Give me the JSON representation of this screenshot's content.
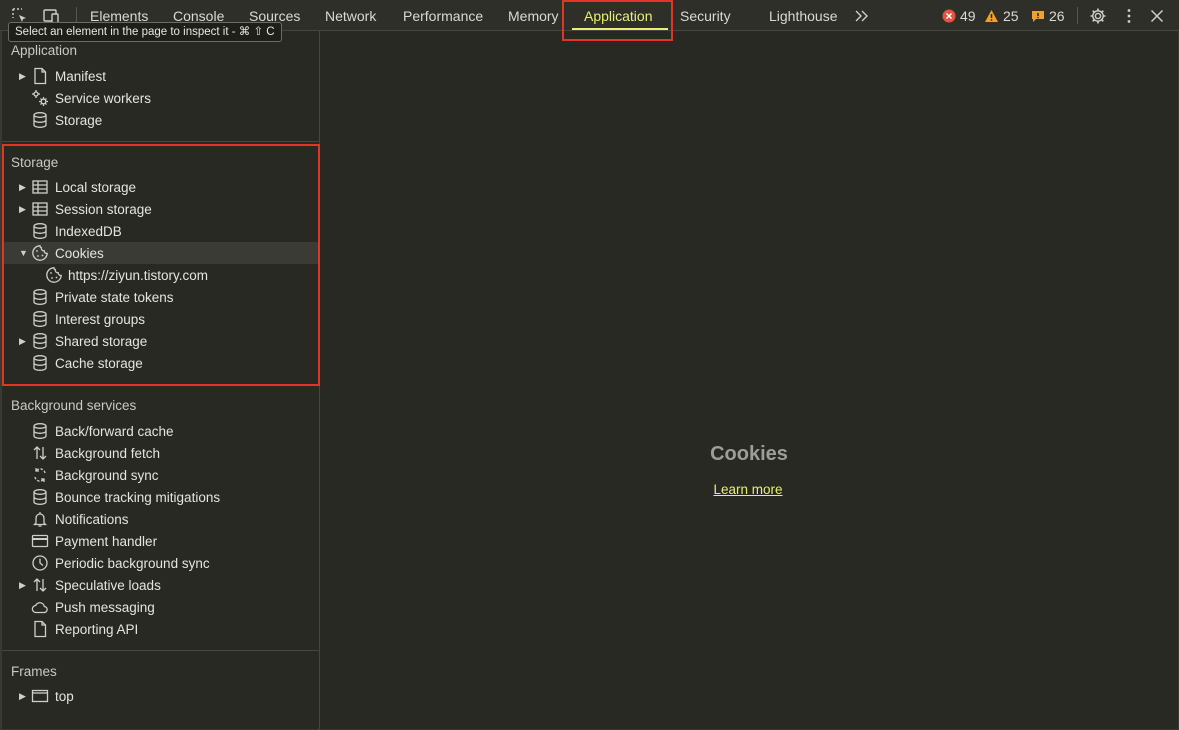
{
  "toolbar": {
    "tabs": [
      "Elements",
      "Console",
      "Sources",
      "Network",
      "Performance",
      "Memory",
      "Application",
      "Security",
      "Lighthouse"
    ],
    "active_tab": "Application",
    "more_tabs_icon": "chevron-double-right-icon",
    "errors": "49",
    "warnings": "25",
    "issues": "26",
    "tooltip": "Select an element in the page to inspect it - ⌘ ⇧ C",
    "accent_color": "#e7ef74",
    "highlight_color": "#e0352b"
  },
  "sidebar": {
    "application": {
      "title": "Application",
      "items": [
        "Manifest",
        "Service workers",
        "Storage"
      ]
    },
    "storage": {
      "title": "Storage",
      "items": [
        "Local storage",
        "Session storage",
        "IndexedDB",
        "Cookies",
        "https://ziyun.tistory.com",
        "Private state tokens",
        "Interest groups",
        "Shared storage",
        "Cache storage"
      ]
    },
    "background_services": {
      "title": "Background services",
      "items": [
        "Back/forward cache",
        "Background fetch",
        "Background sync",
        "Bounce tracking mitigations",
        "Notifications",
        "Payment handler",
        "Periodic background sync",
        "Speculative loads",
        "Push messaging",
        "Reporting API"
      ]
    },
    "frames": {
      "title": "Frames",
      "items": [
        "top"
      ]
    }
  },
  "main": {
    "title": "Cookies",
    "link": "Learn more"
  }
}
